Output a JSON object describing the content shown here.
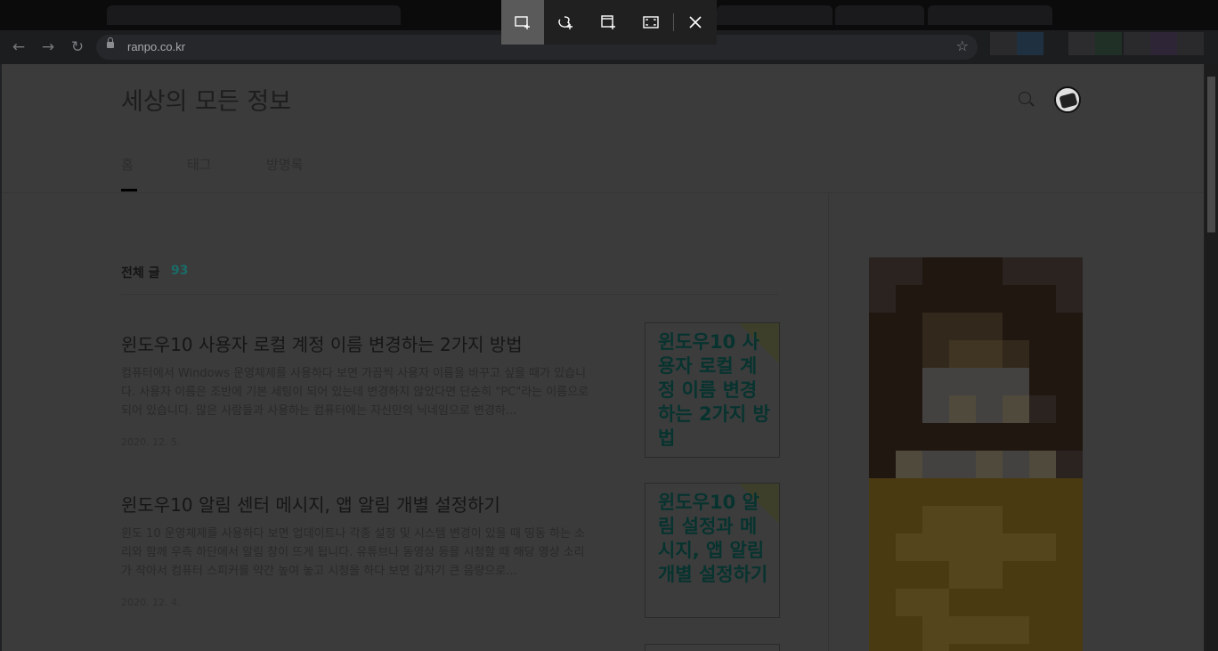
{
  "browser": {
    "url": "ranpo.co.kr",
    "back_icon": "arrow-left-icon",
    "forward_icon": "arrow-right-icon",
    "reload_icon": "reload-icon",
    "bookmark_icon": "star-icon"
  },
  "snip_toolbar": {
    "modes": [
      "rectangle-snip-icon",
      "freeform-snip-icon",
      "window-snip-icon",
      "fullscreen-snip-icon"
    ],
    "active_mode": "rectangle-snip-icon",
    "close_icon": "close-icon"
  },
  "blog": {
    "title": "세상의 모든 정보",
    "nav": [
      "홈",
      "태그",
      "방명록"
    ],
    "active_nav": "홈",
    "total_label": "전체 글",
    "total_count": "93",
    "accent_color": "#1a6b68"
  },
  "posts": [
    {
      "title": "윈도우10 사용자 로컬 계정 이름 변경하는 2가지 방법",
      "summary": "컴퓨터에서 Windows 운영체제를 사용하다 보면 가끔씩 사용자 이름을 바꾸고 싶을 때가 있습니다. 사용자 이름은 조반에 기본 세팅이 되어 있는데 변경하지 않았다면 단순히 \"PC\"라는 이름으로 되어 있습니다. 많은 사람들과 사용하는 컴퓨터에는 자신만의 닉네임으로 변경하...",
      "date": "2020. 12. 5.",
      "thumb_text": "윈도우10 사용자 로컬 계정 이름 변경하는 2가지 방법"
    },
    {
      "title": "윈도우10 알림 센터 메시지, 앱 알림 개별 설정하기",
      "summary": "윈도 10 운영체제를 사용하다 보면 업데이트나 각종 설정 및 시스템 변경이 있을 때 띵동 하는 소리와 함께 우측 하단에서 알림 창이 뜨게 됩니다. 유튜브나 동영상 등을 시청할 때 해당 영상 소리가 작아서 컴퓨터 스피커를 약간 높여 놓고 시청을 하다 보면 갑자기 큰 음량으로...",
      "date": "2020. 12. 4.",
      "thumb_text": "윈도우10 알림 설정과 메시지, 앱 알림 개별 설정하기"
    }
  ]
}
